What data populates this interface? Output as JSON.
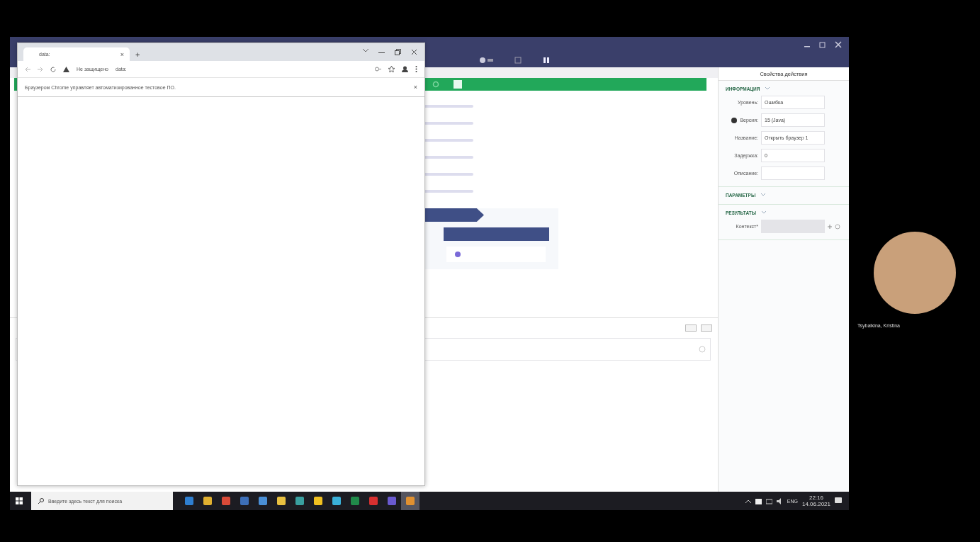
{
  "shared_screen": {
    "browser": {
      "tab": {
        "title": "data:",
        "close": "×"
      },
      "new_tab": "+",
      "security": "Не защищено",
      "address": "data:",
      "infobar": "Браузером Chrome управляет автоматизированное тестовое ПО.",
      "infobar_close": "×"
    },
    "studio": {
      "properties": {
        "title": "Свойства действия",
        "sections": [
          {
            "title": "ИНФОРМАЦИЯ",
            "fields": [
              {
                "label": "Уровень:",
                "value": "Ошибка",
                "info": false
              },
              {
                "label": "Версия:",
                "value": "15 (Java)",
                "info": true
              },
              {
                "label": "Название:",
                "value": "Открыть браузер 1",
                "info": false
              },
              {
                "label": "Задержка:",
                "value": "0",
                "info": false
              },
              {
                "label": "Описание:",
                "info": false
              }
            ]
          },
          {
            "title": "ПАРАМЕТРЫ"
          },
          {
            "title": "РЕЗУЛЬТАТЫ",
            "fields": [
              {
                "label": "Контекст*",
                "info": false
              }
            ]
          }
        ]
      }
    },
    "taskbar": {
      "search_placeholder": "Введите здесь текст для поиска",
      "apps": [
        {
          "color": "#2f7fd0",
          "selected": false
        },
        {
          "color": "#e0b030",
          "selected": false
        },
        {
          "color": "#d84a38",
          "selected": false
        },
        {
          "color": "#3d6fb8",
          "selected": false
        },
        {
          "color": "#4a8fd6",
          "selected": false
        },
        {
          "color": "#e8c040",
          "selected": false
        },
        {
          "color": "#3aa0a0",
          "selected": false
        },
        {
          "color": "#f0c020",
          "selected": false
        },
        {
          "color": "#3ab0d8",
          "selected": false
        },
        {
          "color": "#218a4a",
          "selected": false
        },
        {
          "color": "#d83030",
          "selected": false
        },
        {
          "color": "#6a5ad0",
          "selected": false
        },
        {
          "color": "#e09030",
          "selected": true
        }
      ],
      "language": "ENG",
      "time": "22:16",
      "date": "14.06.2021"
    }
  },
  "participant": {
    "name": "Tsybaikina, Kristina"
  }
}
